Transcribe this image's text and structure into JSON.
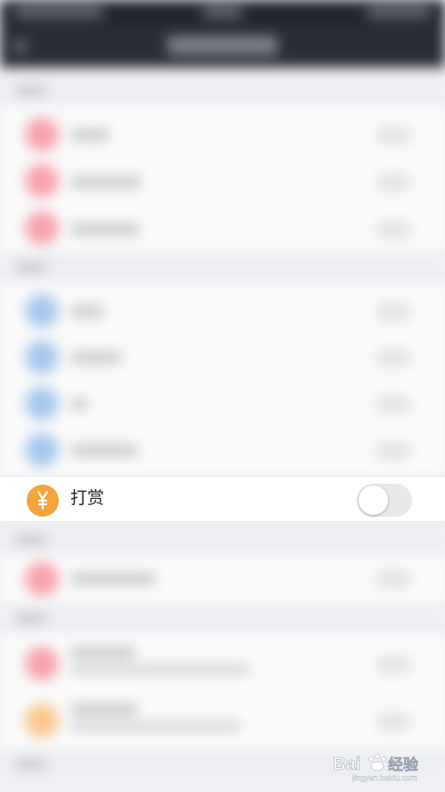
{
  "reward_setting": {
    "label": "打赏",
    "icon": "yuan-coin-icon",
    "enabled": false,
    "accent_color": "#f4a53b"
  },
  "watermark": {
    "text": "Bai du 经验",
    "url": "jingyan.baidu.com"
  }
}
